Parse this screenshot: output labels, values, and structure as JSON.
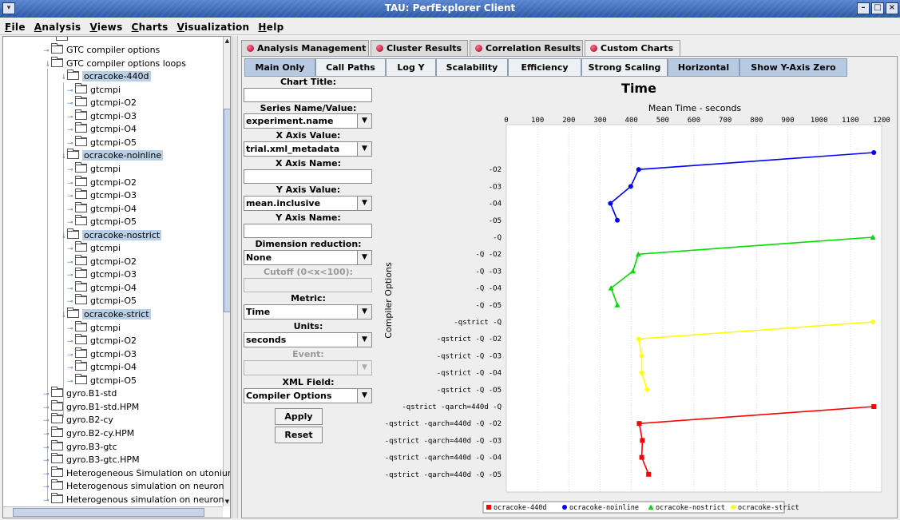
{
  "window": {
    "title": "TAU: PerfExplorer Client",
    "menu": [
      {
        "label": "File",
        "u": "F",
        "rest": "ile"
      },
      {
        "label": "Analysis",
        "u": "A",
        "rest": "nalysis"
      },
      {
        "label": "Views",
        "u": "V",
        "rest": "iews"
      },
      {
        "label": "Charts",
        "u": "C",
        "rest": "harts"
      },
      {
        "label": "Visualization",
        "u": "V",
        "rest": "isualization"
      },
      {
        "label": "Help",
        "u": "H",
        "rest": "elp"
      }
    ]
  },
  "tree": {
    "items": [
      {
        "label": "GTC compiler options",
        "depth": 1,
        "selected": false
      },
      {
        "label": "GTC compiler options loops",
        "depth": 1,
        "selected": false
      },
      {
        "label": "ocracoke-440d",
        "depth": 2,
        "selected": true
      },
      {
        "label": "gtcmpi",
        "depth": 3,
        "selected": false
      },
      {
        "label": "gtcmpi-O2",
        "depth": 3,
        "selected": false
      },
      {
        "label": "gtcmpi-O3",
        "depth": 3,
        "selected": false
      },
      {
        "label": "gtcmpi-O4",
        "depth": 3,
        "selected": false
      },
      {
        "label": "gtcmpi-O5",
        "depth": 3,
        "selected": false
      },
      {
        "label": "ocracoke-noinline",
        "depth": 2,
        "selected": true
      },
      {
        "label": "gtcmpi",
        "depth": 3,
        "selected": false
      },
      {
        "label": "gtcmpi-O2",
        "depth": 3,
        "selected": false
      },
      {
        "label": "gtcmpi-O3",
        "depth": 3,
        "selected": false
      },
      {
        "label": "gtcmpi-O4",
        "depth": 3,
        "selected": false
      },
      {
        "label": "gtcmpi-O5",
        "depth": 3,
        "selected": false
      },
      {
        "label": "ocracoke-nostrict",
        "depth": 2,
        "selected": true
      },
      {
        "label": "gtcmpi",
        "depth": 3,
        "selected": false
      },
      {
        "label": "gtcmpi-O2",
        "depth": 3,
        "selected": false
      },
      {
        "label": "gtcmpi-O3",
        "depth": 3,
        "selected": false
      },
      {
        "label": "gtcmpi-O4",
        "depth": 3,
        "selected": false
      },
      {
        "label": "gtcmpi-O5",
        "depth": 3,
        "selected": false
      },
      {
        "label": "ocracoke-strict",
        "depth": 2,
        "selected": true
      },
      {
        "label": "gtcmpi",
        "depth": 3,
        "selected": false
      },
      {
        "label": "gtcmpi-O2",
        "depth": 3,
        "selected": false
      },
      {
        "label": "gtcmpi-O3",
        "depth": 3,
        "selected": false
      },
      {
        "label": "gtcmpi-O4",
        "depth": 3,
        "selected": false
      },
      {
        "label": "gtcmpi-O5",
        "depth": 3,
        "selected": false
      },
      {
        "label": "gyro.B1-std",
        "depth": 1,
        "selected": false
      },
      {
        "label": "gyro.B1-std.HPM",
        "depth": 1,
        "selected": false
      },
      {
        "label": "gyro.B2-cy",
        "depth": 1,
        "selected": false
      },
      {
        "label": "gyro.B2-cy.HPM",
        "depth": 1,
        "selected": false
      },
      {
        "label": "gyro.B3-gtc",
        "depth": 1,
        "selected": false
      },
      {
        "label": "gyro.B3-gtc.HPM",
        "depth": 1,
        "selected": false
      },
      {
        "label": "Heterogeneous Simulation on utonium",
        "depth": 1,
        "selected": false
      },
      {
        "label": "Heterogenous simulation on neuron",
        "depth": 1,
        "selected": false
      },
      {
        "label": "Heterogenous simulation on neuron",
        "depth": 1,
        "selected": false
      }
    ]
  },
  "tabs": [
    {
      "label": "Analysis Management",
      "active": false
    },
    {
      "label": "Cluster Results",
      "active": false
    },
    {
      "label": "Correlation Results",
      "active": false
    },
    {
      "label": "Custom Charts",
      "active": true
    }
  ],
  "toolbar": [
    {
      "label": "Main Only",
      "on": true
    },
    {
      "label": "Call Paths",
      "on": false
    },
    {
      "label": "Log Y",
      "on": false
    },
    {
      "label": "Scalability",
      "on": false
    },
    {
      "label": "Efficiency",
      "on": false
    },
    {
      "label": "Strong Scaling",
      "on": false
    },
    {
      "label": "Horizontal",
      "on": true
    },
    {
      "label": "Show Y-Axis Zero",
      "on": true
    }
  ],
  "form": {
    "chart_title_label": "Chart Title:",
    "chart_title_value": "",
    "series_label": "Series Name/Value:",
    "series_value": "experiment.name",
    "xaxis_value_label": "X Axis Value:",
    "xaxis_value": "trial.xml_metadata",
    "xaxis_name_label": "X Axis Name:",
    "xaxis_name_value": "",
    "yaxis_value_label": "Y Axis Value:",
    "yaxis_value": "mean.inclusive",
    "yaxis_name_label": "Y Axis Name:",
    "yaxis_name_value": "",
    "dimred_label": "Dimension reduction:",
    "dimred_value": "None",
    "cutoff_label": "Cutoff (0<x<100):",
    "cutoff_value": "",
    "metric_label": "Metric:",
    "metric_value": "Time",
    "units_label": "Units:",
    "units_value": "seconds",
    "event_label": "Event:",
    "event_value": "",
    "xml_label": "XML Field:",
    "xml_value": "Compiler Options",
    "apply_label": "Apply",
    "reset_label": "Reset"
  },
  "chart_data": {
    "type": "line",
    "orientation": "horizontal",
    "title": "Time",
    "xlabel": "Mean Time - seconds",
    "ylabel": "Compiler Options",
    "xlim": [
      0,
      1200
    ],
    "xticks": [
      0,
      100,
      200,
      300,
      400,
      500,
      600,
      700,
      800,
      900,
      1000,
      1100,
      1200
    ],
    "grid": true,
    "legend_position": "bottom",
    "categories": [
      "",
      "-O2",
      "-O3",
      "-O4",
      "-O5",
      "-Q",
      "-Q -O2",
      "-Q -O3",
      "-Q -O4",
      "-Q -O5",
      "-qstrict -Q",
      "-qstrict -Q -O2",
      "-qstrict -Q -O3",
      "-qstrict -Q -O4",
      "-qstrict -Q -O5",
      "-qstrict -qarch=440d -Q",
      "-qstrict -qarch=440d -Q -O2",
      "-qstrict -qarch=440d -Q -O3",
      "-qstrict -qarch=440d -Q -O4",
      "-qstrict -qarch=440d -Q -O5"
    ],
    "series": [
      {
        "name": "ocracoke-440d",
        "color": "#ff0000",
        "marker": "square",
        "start_index": 15,
        "values": [
          1175,
          425,
          435,
          433,
          455
        ]
      },
      {
        "name": "ocracoke-noinline",
        "color": "#0000ff",
        "marker": "circle",
        "start_index": 0,
        "values": [
          1175,
          423,
          398,
          333,
          355
        ]
      },
      {
        "name": "ocracoke-nostrict",
        "color": "#00dd00",
        "marker": "triangle",
        "start_index": 5,
        "values": [
          1172,
          422,
          405,
          335,
          355
        ]
      },
      {
        "name": "ocracoke-strict",
        "color": "#ffff00",
        "marker": "diamond",
        "start_index": 10,
        "values": [
          1172,
          423,
          433,
          433,
          450
        ]
      }
    ]
  }
}
